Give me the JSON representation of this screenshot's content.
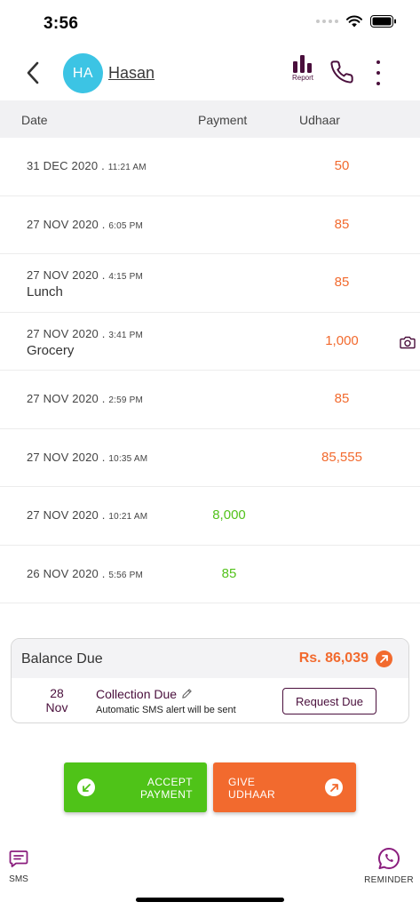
{
  "status_bar": {
    "time": "3:56"
  },
  "header": {
    "avatar_initials": "HA",
    "contact_name": "Hasan",
    "report_label": "Report"
  },
  "table": {
    "columns": {
      "date": "Date",
      "payment": "Payment",
      "udhaar": "Udhaar"
    }
  },
  "transactions": [
    {
      "date": "31 DEC 2020 .",
      "time": "11:21 AM",
      "note": "",
      "payment": "",
      "udhaar": "50",
      "has_photo": false
    },
    {
      "date": "27 NOV 2020 .",
      "time": "6:05 PM",
      "note": "",
      "payment": "",
      "udhaar": "85",
      "has_photo": false
    },
    {
      "date": "27 NOV 2020 .",
      "time": "4:15 PM",
      "note": "Lunch",
      "payment": "",
      "udhaar": "85",
      "has_photo": false
    },
    {
      "date": "27 NOV 2020 .",
      "time": "3:41 PM",
      "note": "Grocery",
      "payment": "",
      "udhaar": "1,000",
      "has_photo": true
    },
    {
      "date": "27 NOV 2020 .",
      "time": "2:59 PM",
      "note": "",
      "payment": "",
      "udhaar": "85",
      "has_photo": false
    },
    {
      "date": "27 NOV 2020 .",
      "time": "10:35 AM",
      "note": "",
      "payment": "",
      "udhaar": "85,555",
      "has_photo": false
    },
    {
      "date": "27 NOV 2020 .",
      "time": "10:21 AM",
      "note": "",
      "payment": "8,000",
      "udhaar": "",
      "has_photo": false
    },
    {
      "date": "26 NOV 2020 .",
      "time": "5:56 PM",
      "note": "",
      "payment": "85",
      "udhaar": "",
      "has_photo": false
    }
  ],
  "balance": {
    "label": "Balance Due",
    "amount": "Rs. 86,039",
    "due_day": "28",
    "due_month": "Nov",
    "collection_title": "Collection Due",
    "collection_subtitle": "Automatic SMS alert will be sent",
    "request_label": "Request Due"
  },
  "actions": {
    "accept_line1": "ACCEPT",
    "accept_line2": "PAYMENT",
    "give_line1": "GIVE",
    "give_line2": "UDHAAR"
  },
  "bottom": {
    "sms_label": "SMS",
    "reminder_label": "REMINDER"
  },
  "colors": {
    "brand": "#4a0f3c",
    "udhaar": "#f26a2e",
    "payment": "#53c21c",
    "avatar": "#3cc4e4"
  },
  "icons": {
    "back": "chevron-left-icon",
    "report": "bar-chart-icon",
    "call": "phone-icon",
    "more": "more-vertical-icon",
    "camera": "camera-icon",
    "edit": "pencil-icon",
    "sms": "message-icon",
    "reminder": "whatsapp-icon"
  }
}
